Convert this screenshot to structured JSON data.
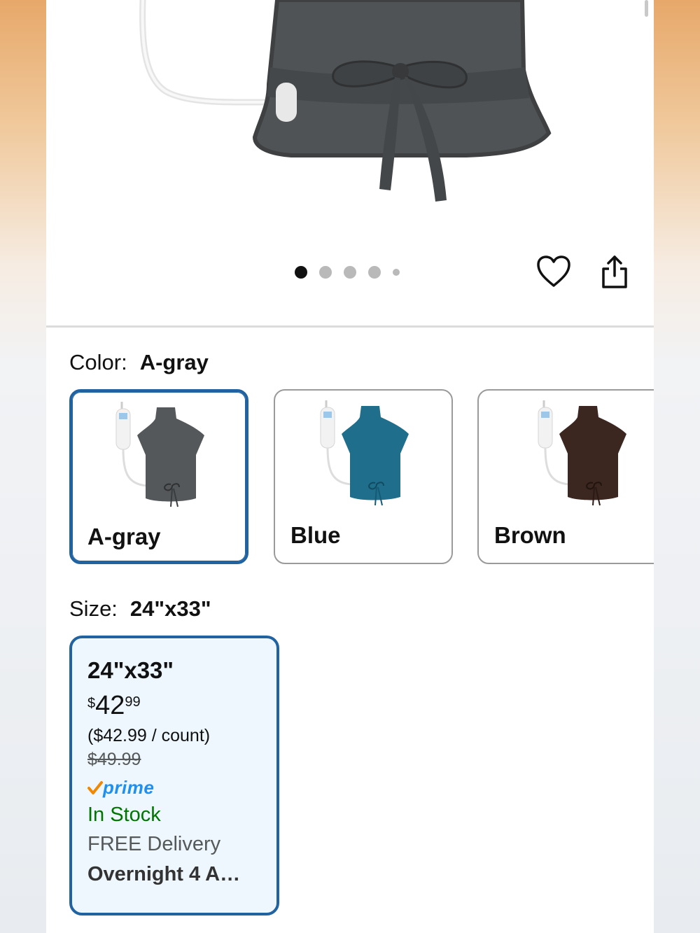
{
  "gallery": {
    "image_alt": "Heating pad shawl, gray",
    "pages_count": 5,
    "active_page": 1
  },
  "actions": {
    "wishlist_icon": "heart-icon",
    "share_icon": "share-icon"
  },
  "color": {
    "label": "Color:",
    "selected": "A-gray",
    "options": [
      {
        "name": "A-gray",
        "hex": "#55585b"
      },
      {
        "name": "Blue",
        "hex": "#1f6e8c"
      },
      {
        "name": "Brown",
        "hex": "#3b2620"
      }
    ]
  },
  "size": {
    "label": "Size:",
    "selected": "24\"x33\"",
    "option": {
      "title": "24\"x33\"",
      "price_symbol": "$",
      "price_whole": "42",
      "price_fraction": "99",
      "unit_price": "($42.99 / count)",
      "list_price": "$49.99",
      "prime_label": "prime",
      "availability": "In Stock",
      "delivery_label": "FREE Delivery",
      "delivery_eta": "Overnight 4 A…"
    }
  },
  "colors": {
    "selected_border": "#2162a1",
    "selected_bg": "#edf7fd",
    "in_stock": "#007600",
    "prime_blue": "#1f8ff0",
    "prime_check": "#f08804"
  }
}
